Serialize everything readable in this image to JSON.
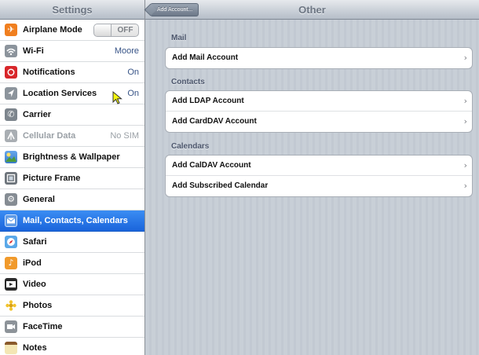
{
  "left_pane": {
    "title": "Settings",
    "items": [
      {
        "label": "Airplane Mode",
        "toggle": "OFF",
        "icon": "airplane-icon",
        "color": "#f07f1f"
      },
      {
        "label": "Wi-Fi",
        "value": "Moore",
        "icon": "wifi-icon",
        "color": "#8c949c"
      },
      {
        "label": "Notifications",
        "value": "On",
        "icon": "notifications-icon",
        "color": "#d8262a"
      },
      {
        "label": "Location Services",
        "value": "On",
        "icon": "location-icon",
        "color": "#8c949c"
      },
      {
        "label": "Carrier",
        "value": "",
        "icon": "phone-icon",
        "color": "#7d858d"
      },
      {
        "label": "Cellular Data",
        "value": "No SIM",
        "icon": "cellular-icon",
        "color": "#a9aeb3"
      },
      {
        "label": "Brightness & Wallpaper",
        "value": "",
        "icon": "brightness-icon",
        "color": "#4f8ed6"
      },
      {
        "label": "Picture Frame",
        "value": "",
        "icon": "picture-frame-icon",
        "color": "#6d747b"
      },
      {
        "label": "General",
        "value": "",
        "icon": "gear-icon",
        "color": "#858c93"
      },
      {
        "label": "Mail, Contacts, Calendars",
        "value": "",
        "icon": "mail-icon",
        "color": "#5e9ae6"
      },
      {
        "label": "Safari",
        "value": "",
        "icon": "safari-icon",
        "color": "#5aa8e8"
      },
      {
        "label": "iPod",
        "value": "",
        "icon": "ipod-icon",
        "color": "#f19a2b"
      },
      {
        "label": "Video",
        "value": "",
        "icon": "video-icon",
        "color": "#2a2a2a"
      },
      {
        "label": "Photos",
        "value": "",
        "icon": "photos-icon",
        "color": "#f2c42c"
      },
      {
        "label": "FaceTime",
        "value": "",
        "icon": "facetime-icon",
        "color": "#8d9399"
      },
      {
        "label": "Notes",
        "value": "",
        "icon": "notes-icon",
        "color": "#c8a36a"
      }
    ],
    "selected_index": 9
  },
  "right_pane": {
    "back_label": "Add Account...",
    "title": "Other",
    "sections": [
      {
        "header": "Mail",
        "rows": [
          "Add Mail Account"
        ]
      },
      {
        "header": "Contacts",
        "rows": [
          "Add LDAP Account",
          "Add CardDAV Account"
        ]
      },
      {
        "header": "Calendars",
        "rows": [
          "Add CalDAV Account",
          "Add Subscribed Calendar"
        ]
      }
    ],
    "chevron": "›"
  },
  "colors": {
    "selected_row": "#1a64db",
    "value_text": "#385487",
    "background": "#c5ccd4"
  }
}
